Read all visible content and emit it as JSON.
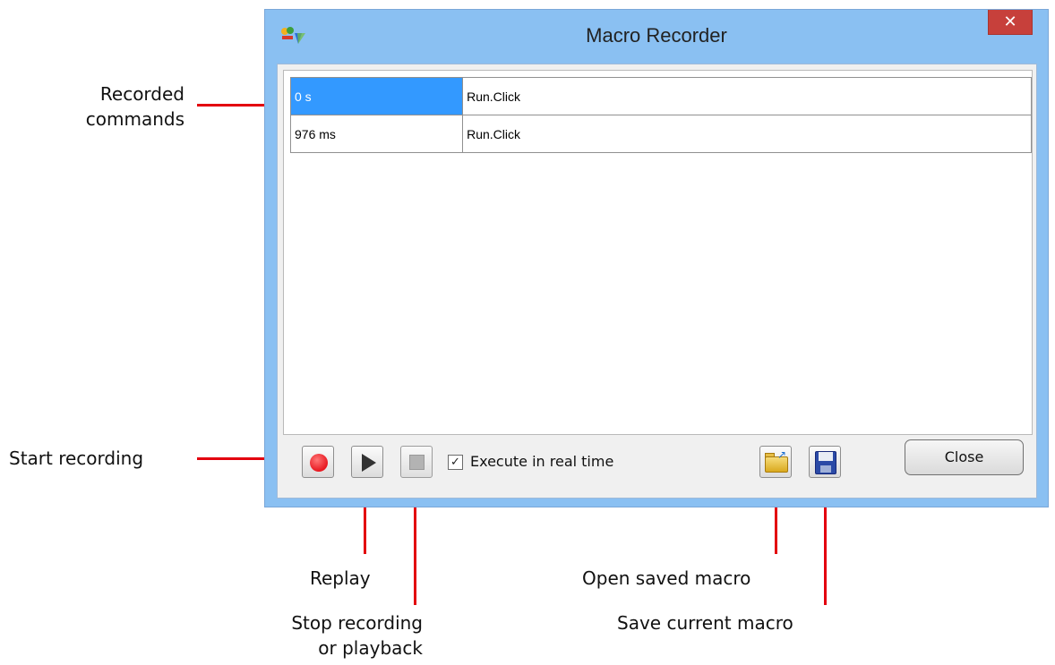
{
  "window": {
    "title": "Macro Recorder",
    "close_glyph": "✕"
  },
  "commands": [
    {
      "time": "0 s",
      "command": "Run.Click",
      "selected": true
    },
    {
      "time": "976 ms",
      "command": "Run.Click",
      "selected": false
    }
  ],
  "toolbar": {
    "record_icon": "record-icon",
    "play_icon": "play-icon",
    "stop_icon": "stop-icon",
    "realtime_label": "Execute in real time",
    "realtime_checked": true,
    "check_glyph": "✓",
    "open_icon": "open-folder-icon",
    "save_icon": "floppy-disk-icon",
    "close_label": "Close"
  },
  "callouts": {
    "recorded_commands_line1": "Recorded",
    "recorded_commands_line2": "commands",
    "start_recording": "Start recording",
    "replay": "Replay",
    "stop_line1": "Stop recording",
    "stop_line2": "or playback",
    "open_saved": "Open saved macro",
    "save_current": "Save current macro"
  },
  "colors": {
    "titlebar": "#8ac0f2",
    "close_red": "#c7403b",
    "selection": "#3399ff",
    "callout_red": "#e3000f"
  }
}
